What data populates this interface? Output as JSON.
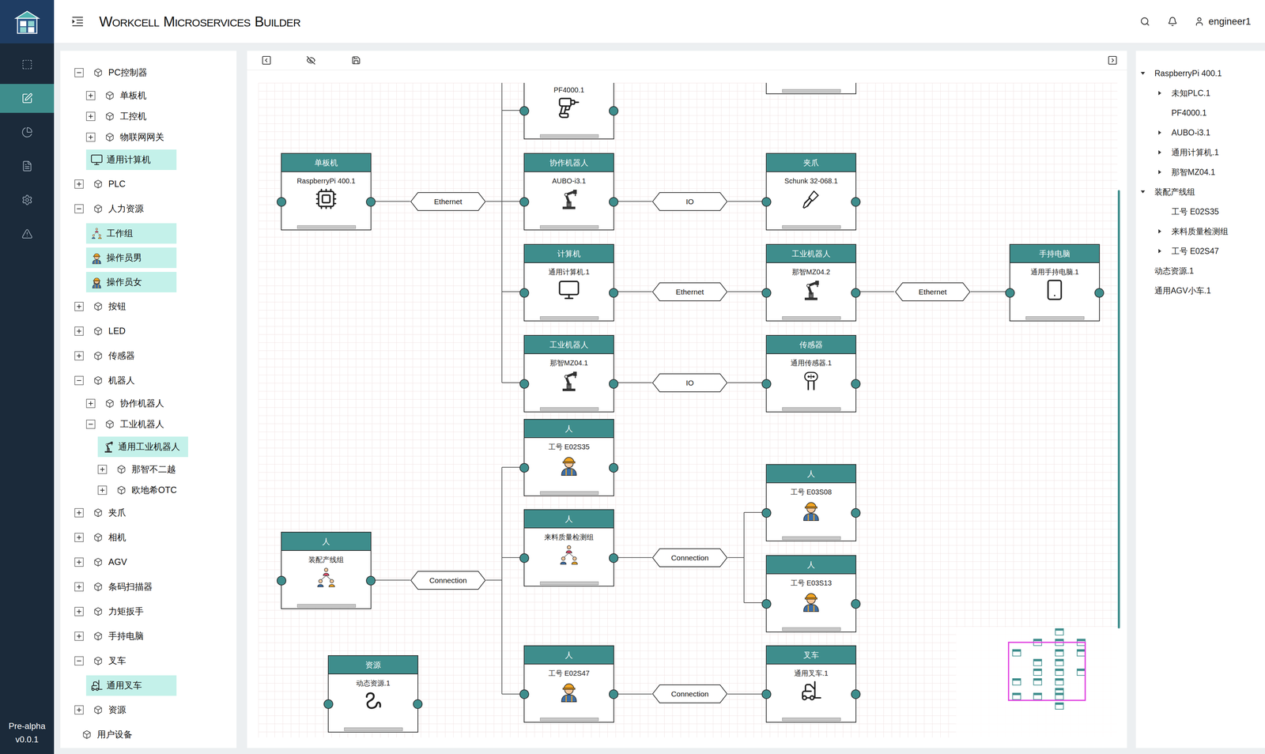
{
  "app": {
    "title": "WORKCELL MICROSERVICES BUILDER",
    "stage": "Pre-alpha",
    "version": "v0.0.1"
  },
  "nav": [
    {
      "selected": false
    },
    {
      "selected": true
    },
    {
      "selected": false
    },
    {
      "selected": false
    },
    {
      "selected": false
    },
    {
      "selected": false
    }
  ],
  "user": {
    "name": "engineer1"
  },
  "library": [
    {
      "label": "PC控制器",
      "depth": 0,
      "kind": "folder",
      "expanded": true,
      "highlighted": false
    },
    {
      "label": "单板机",
      "depth": 1,
      "kind": "folder",
      "expanded": false,
      "highlighted": false
    },
    {
      "label": "工控机",
      "depth": 1,
      "kind": "folder",
      "expanded": false,
      "highlighted": false
    },
    {
      "label": "物联网网关",
      "depth": 1,
      "kind": "folder",
      "expanded": false,
      "highlighted": false
    },
    {
      "label": "通用计算机",
      "depth": 1,
      "kind": "computer",
      "expanded": false,
      "highlighted": true
    },
    {
      "label": "PLC",
      "depth": 0,
      "kind": "folder",
      "expanded": false,
      "highlighted": false
    },
    {
      "label": "人力资源",
      "depth": 0,
      "kind": "folder",
      "expanded": true,
      "highlighted": false
    },
    {
      "label": "工作组",
      "depth": 1,
      "kind": "team",
      "expanded": false,
      "highlighted": true
    },
    {
      "label": "操作员男",
      "depth": 1,
      "kind": "male",
      "expanded": false,
      "highlighted": true
    },
    {
      "label": "操作员女",
      "depth": 1,
      "kind": "female",
      "expanded": false,
      "highlighted": true
    },
    {
      "label": "按钮",
      "depth": 0,
      "kind": "folder",
      "expanded": false,
      "highlighted": false
    },
    {
      "label": "LED",
      "depth": 0,
      "kind": "folder",
      "expanded": false,
      "highlighted": false
    },
    {
      "label": "传感器",
      "depth": 0,
      "kind": "folder",
      "expanded": false,
      "highlighted": false
    },
    {
      "label": "机器人",
      "depth": 0,
      "kind": "folder",
      "expanded": true,
      "highlighted": false
    },
    {
      "label": "协作机器人",
      "depth": 1,
      "kind": "folder",
      "expanded": false,
      "highlighted": false
    },
    {
      "label": "工业机器人",
      "depth": 1,
      "kind": "folder",
      "expanded": true,
      "highlighted": false
    },
    {
      "label": "通用工业机器人",
      "depth": 2,
      "kind": "robot",
      "expanded": false,
      "highlighted": true
    },
    {
      "label": "那智不二越",
      "depth": 2,
      "kind": "folder",
      "expanded": false,
      "highlighted": false
    },
    {
      "label": "欧地希OTC",
      "depth": 2,
      "kind": "folder",
      "expanded": false,
      "highlighted": false
    },
    {
      "label": "夹爪",
      "depth": 0,
      "kind": "folder",
      "expanded": false,
      "highlighted": false
    },
    {
      "label": "相机",
      "depth": 0,
      "kind": "folder",
      "expanded": false,
      "highlighted": false
    },
    {
      "label": "AGV",
      "depth": 0,
      "kind": "folder",
      "expanded": false,
      "highlighted": false
    },
    {
      "label": "条码扫描器",
      "depth": 0,
      "kind": "folder",
      "expanded": false,
      "highlighted": false
    },
    {
      "label": "力矩扳手",
      "depth": 0,
      "kind": "folder",
      "expanded": false,
      "highlighted": false
    },
    {
      "label": "手持电脑",
      "depth": 0,
      "kind": "folder",
      "expanded": false,
      "highlighted": false
    },
    {
      "label": "叉车",
      "depth": 0,
      "kind": "folder",
      "expanded": true,
      "highlighted": false
    },
    {
      "label": "通用叉车",
      "depth": 1,
      "kind": "forklift",
      "expanded": false,
      "highlighted": true
    },
    {
      "label": "资源",
      "depth": 0,
      "kind": "folder",
      "expanded": false,
      "highlighted": false
    },
    {
      "label": "用户设备",
      "depth": 0,
      "kind": "device",
      "expanded": false,
      "highlighted": false
    }
  ],
  "diagram": {
    "nodes": [
      {
        "name": "PF4000.1",
        "kind": "drill"
      },
      {
        "category": "单板机",
        "name": "RaspberryPi 400.1",
        "kind": "board"
      },
      {
        "category": "协作机器人",
        "name": "AUBO-i3.1",
        "kind": "cobot"
      },
      {
        "category": "夹爪",
        "name": "Schunk 32-068.1",
        "kind": "gripper"
      },
      {
        "category": "计算机",
        "name": "通用计算机.1",
        "kind": "computer"
      },
      {
        "category": "工业机器人",
        "name": "那智MZ04.2",
        "kind": "robot"
      },
      {
        "category": "手持电脑",
        "name": "通用手持电脑.1",
        "kind": "handheld"
      },
      {
        "category": "工业机器人",
        "name": "那智MZ04.1",
        "kind": "robot"
      },
      {
        "category": "传感器",
        "name": "通用传感器.1",
        "kind": "sensor"
      },
      {
        "category": "人",
        "name": "工号 E02S35",
        "kind": "person"
      },
      {
        "category": "人",
        "name": "工号 E03S08",
        "kind": "person"
      },
      {
        "category": "人",
        "name": "来料质量检测组",
        "kind": "group"
      },
      {
        "category": "人",
        "name": "装配产线组",
        "kind": "group"
      },
      {
        "category": "人",
        "name": "工号 E03S13",
        "kind": "person"
      },
      {
        "category": "资源",
        "name": "动态资源.1",
        "kind": "resource"
      },
      {
        "category": "人",
        "name": "工号 E02S47",
        "kind": "person"
      },
      {
        "category": "叉车",
        "name": "通用叉车.1",
        "kind": "forklift"
      }
    ],
    "edges": [
      {
        "label": "Ethernet"
      },
      {
        "label": "IO"
      },
      {
        "label": "Ethernet"
      },
      {
        "label": "Ethernet"
      },
      {
        "label": "IO"
      },
      {
        "label": "Connection"
      },
      {
        "label": "Connection"
      },
      {
        "label": "Connection"
      }
    ]
  },
  "outline": [
    {
      "label": "RaspberryPi 400.1",
      "depth": 0,
      "hasChildren": true,
      "expanded": true
    },
    {
      "label": "未知PLC.1",
      "depth": 1,
      "hasChildren": true,
      "expanded": false
    },
    {
      "label": "PF4000.1",
      "depth": 1,
      "hasChildren": false,
      "expanded": false
    },
    {
      "label": "AUBO-i3.1",
      "depth": 1,
      "hasChildren": true,
      "expanded": false
    },
    {
      "label": "通用计算机.1",
      "depth": 1,
      "hasChildren": true,
      "expanded": false
    },
    {
      "label": "那智MZ04.1",
      "depth": 1,
      "hasChildren": true,
      "expanded": false
    },
    {
      "label": "装配产线组",
      "depth": 0,
      "hasChildren": true,
      "expanded": true
    },
    {
      "label": "工号 E02S35",
      "depth": 1,
      "hasChildren": false,
      "expanded": false
    },
    {
      "label": "来料质量检测组",
      "depth": 1,
      "hasChildren": true,
      "expanded": false
    },
    {
      "label": "工号 E02S47",
      "depth": 1,
      "hasChildren": true,
      "expanded": false
    },
    {
      "label": "动态资源.1",
      "depth": 0,
      "hasChildren": false,
      "expanded": false
    },
    {
      "label": "通用AGV小车.1",
      "depth": 0,
      "hasChildren": false,
      "expanded": false
    }
  ]
}
